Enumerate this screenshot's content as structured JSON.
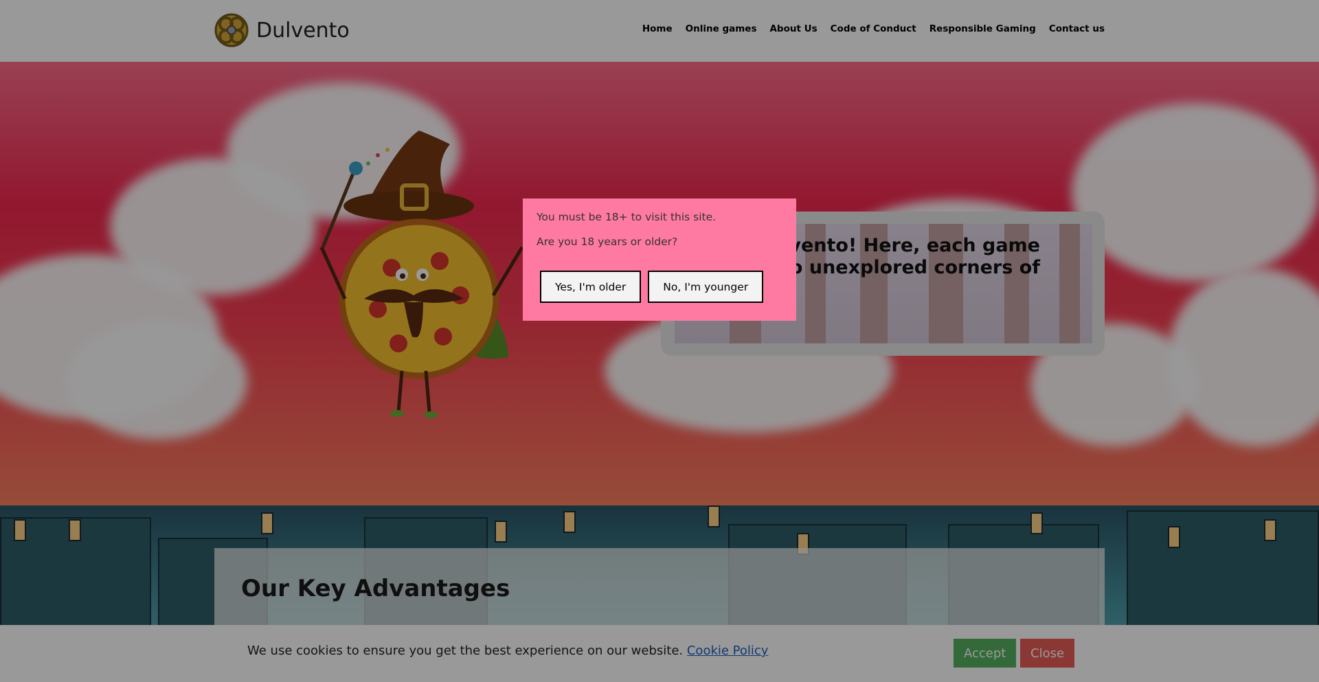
{
  "brand": {
    "name": "Dulvento"
  },
  "nav": {
    "items": [
      "Home",
      "Online games",
      "About Us",
      "Code of Conduct",
      "Responsible Gaming",
      "Contact us"
    ]
  },
  "hero": {
    "welcome_text_line1": "o Dulvento! Here, each game",
    "welcome_text_line2": "y into unexplored corners of"
  },
  "advantages": {
    "title": "Our Key Advantages"
  },
  "age_modal": {
    "line1": "You must be 18+ to visit this site.",
    "line2": "Are you 18 years or older?",
    "yes_label": "Yes, I'm older",
    "no_label": "No, I'm younger"
  },
  "cookie_bar": {
    "text": "We use cookies to ensure you get the best experience on our website.",
    "link_label": "Cookie Policy",
    "accept_label": "Accept",
    "close_label": "Close"
  },
  "colors": {
    "modal_bg": "#ff7aa2",
    "accept_bg": "#57b15f",
    "close_bg": "#e85d56",
    "link": "#1b5fbf"
  },
  "icons": {
    "logo": "celtic-knot-emblem-icon"
  }
}
